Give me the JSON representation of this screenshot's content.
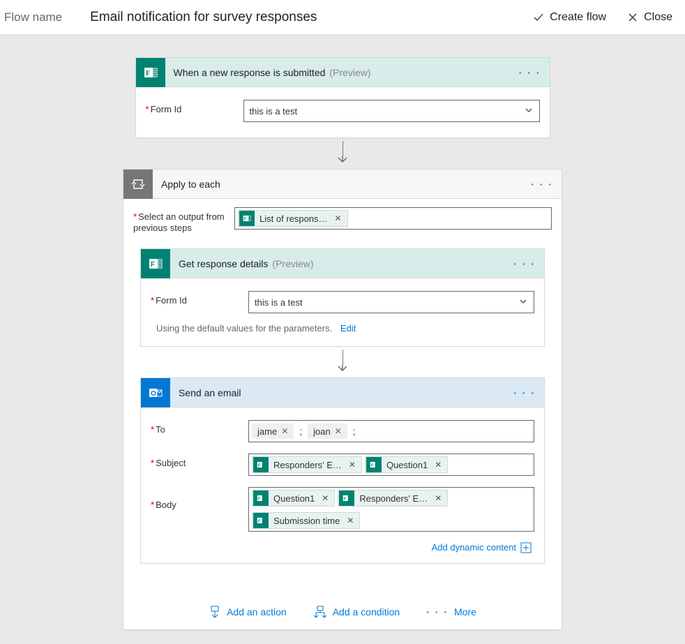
{
  "topbar": {
    "label": "Flow name",
    "title": "Email notification for survey responses",
    "create": "Create flow",
    "close": "Close"
  },
  "trigger": {
    "title": "When a new response is submitted",
    "preview": "(Preview)",
    "menu": "· · ·",
    "formid_label": "Form Id",
    "formid_value": "this is a test"
  },
  "loop": {
    "title": "Apply to each",
    "menu": "· · ·",
    "select_label": "Select an output from previous steps",
    "select_token": "List of respons…",
    "getresp": {
      "title": "Get response details",
      "preview": "(Preview)",
      "menu": "· · ·",
      "formid_label": "Form Id",
      "formid_value": "this is a test",
      "note": "Using the default values for the parameters.",
      "edit": "Edit"
    },
    "email": {
      "title": "Send an email",
      "menu": "· · ·",
      "to_label": "To",
      "to_recip1": "jame",
      "to_recip2": "joan",
      "subject_label": "Subject",
      "subject_t1": "Responders' E…",
      "subject_t2": "Question1",
      "body_label": "Body",
      "body_t1": "Question1",
      "body_t2": "Responders' E…",
      "body_t3": "Submission time",
      "dyn": "Add dynamic content"
    },
    "footer": {
      "addAction": "Add an action",
      "addCondition": "Add a condition",
      "more": "More"
    }
  }
}
